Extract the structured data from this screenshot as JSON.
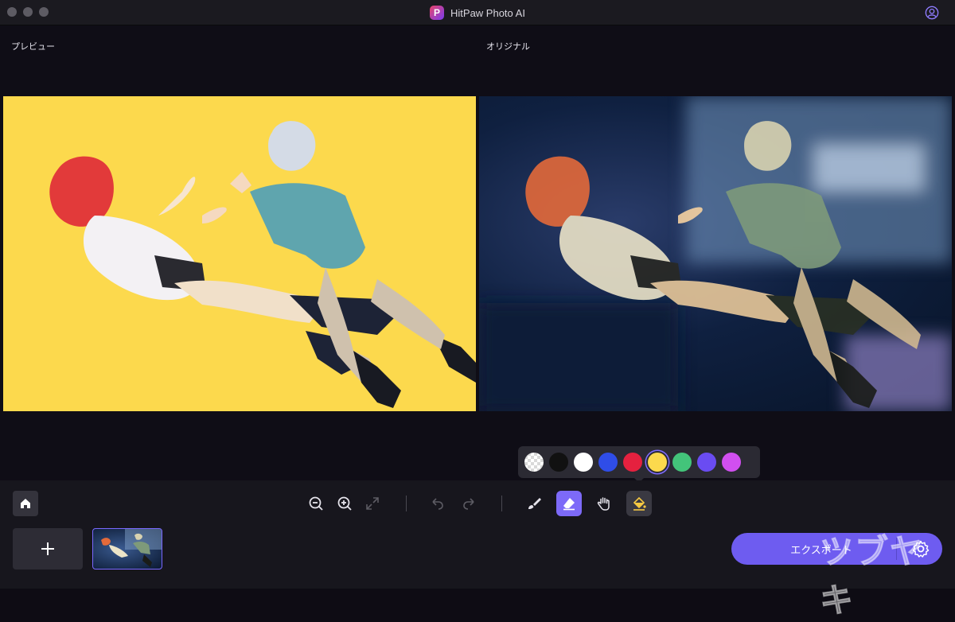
{
  "window": {
    "app_title": "HitPaw Photo AI"
  },
  "panes": {
    "preview_label": "プレビュー",
    "original_label": "オリジナル"
  },
  "palette": {
    "colors": [
      "transparent",
      "#111111",
      "#ffffff",
      "#2f4de8",
      "#e5213f",
      "#fcd94d",
      "#43c47a",
      "#6a4cf2",
      "#d14ff0"
    ],
    "selected": "#fcd94d"
  },
  "toolbar": {
    "tools": [
      "home-icon",
      "zoom-out-icon",
      "zoom-in-icon",
      "fit-screen-icon",
      "undo-icon",
      "redo-icon",
      "brush-icon",
      "eraser-icon",
      "hand-icon",
      "fill-icon"
    ]
  },
  "export": {
    "label": "エクスポート"
  },
  "watermark": "ツブヤキ",
  "colors": {
    "accent": "#7d6af8",
    "background": "#0f0d16",
    "yellow_bg": "#fcd94d"
  }
}
